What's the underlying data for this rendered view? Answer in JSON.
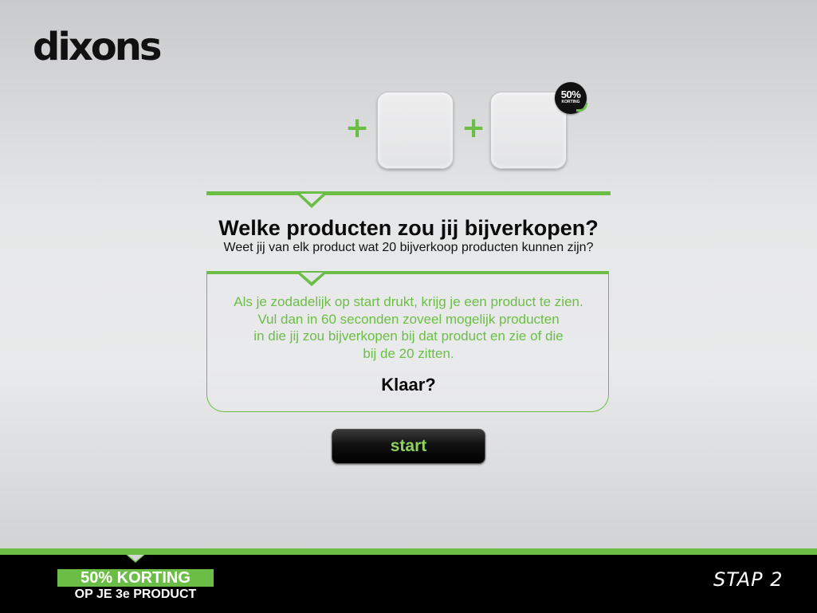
{
  "brand": {
    "logo_text": "dixons"
  },
  "product_slots": {
    "plus_symbol": "+",
    "sticker_percent": "50%",
    "sticker_label": "KORTING"
  },
  "main": {
    "title": "Welke producten zou jij bijverkopen?",
    "subtitle": "Weet jij van elk product wat 20 bijverkoop producten kunnen zijn?",
    "instructions": [
      "Als je zodadelijk op start drukt, krijg je een product te zien.",
      "Vul dan in 60 seconden zoveel mogelijk producten",
      "in die jij zou bijverkopen bij dat product en zie of die",
      "bij de 20 zitten."
    ],
    "ready_text": "Klaar?",
    "start_label": "start"
  },
  "footer": {
    "promo_line1": "50% KORTING",
    "promo_line2": "OP JE 3e PRODUCT",
    "step_label": "STAP 2"
  },
  "colors": {
    "accent": "#6bbe45",
    "dark": "#000000",
    "background": "#e6e7e8"
  }
}
